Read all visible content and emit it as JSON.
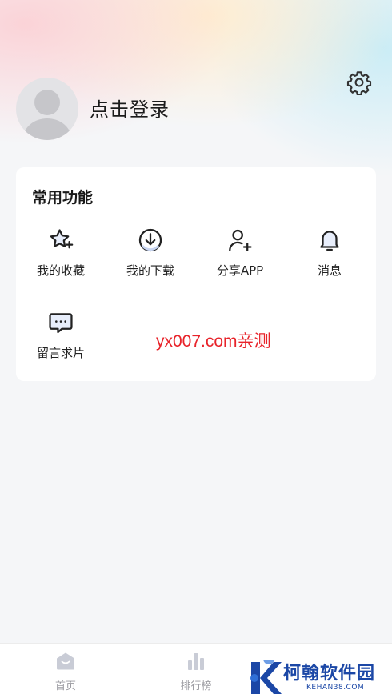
{
  "header": {
    "login_text": "点击登录",
    "settings_icon": "gear-icon",
    "avatar_icon": "default-avatar"
  },
  "functions": {
    "title": "常用功能",
    "items": [
      {
        "label": "我的收藏",
        "icon": "star-icon"
      },
      {
        "label": "我的下载",
        "icon": "download-icon"
      },
      {
        "label": "分享APP",
        "icon": "user-add-icon"
      },
      {
        "label": "消息",
        "icon": "bell-icon"
      },
      {
        "label": "留言求片",
        "icon": "message-icon"
      }
    ]
  },
  "overlay": {
    "watermark": "yx007.com亲测"
  },
  "tabbar": {
    "items": [
      {
        "label": "首页",
        "icon": "home-icon"
      },
      {
        "label": "排行榜",
        "icon": "chart-icon"
      }
    ]
  },
  "brand": {
    "name": "柯翰软件园",
    "sub": "KEHAN38.COM"
  },
  "colors": {
    "accent_blue": "#1b47a6",
    "watermark_red": "#e8232a",
    "tab_icon_gray": "#c9ccd6"
  }
}
